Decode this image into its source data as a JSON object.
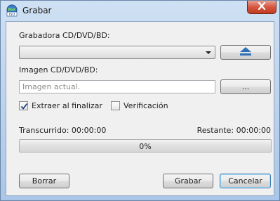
{
  "window": {
    "title": "Grabar",
    "app_icon": "globe-iso-icon",
    "close_icon": "close-icon"
  },
  "recorder": {
    "label": "Grabadora CD/DVD/BD:",
    "selected": "",
    "eject_icon": "eject-icon"
  },
  "image": {
    "label": "Imagen CD/DVD/BD:",
    "placeholder": "Imagen actual.",
    "value": "",
    "browse_label": "..."
  },
  "options": {
    "eject": {
      "label": "Extraer al finalizar",
      "checked": true
    },
    "verify": {
      "label": "Verificación",
      "checked": false
    }
  },
  "status": {
    "elapsed": "Transcurrido: 00:00:00",
    "remaining": "Restante: 00:00:00",
    "progress_text": "0%",
    "progress_fraction": 0
  },
  "buttons": {
    "clear": "Borrar",
    "burn": "Grabar",
    "cancel": "Cancelar"
  },
  "colors": {
    "titlebar": "#b9d1ec",
    "client_bg": "#f0f0f0",
    "close": "#c23a22",
    "eject_blue": "#2e6fb6"
  }
}
